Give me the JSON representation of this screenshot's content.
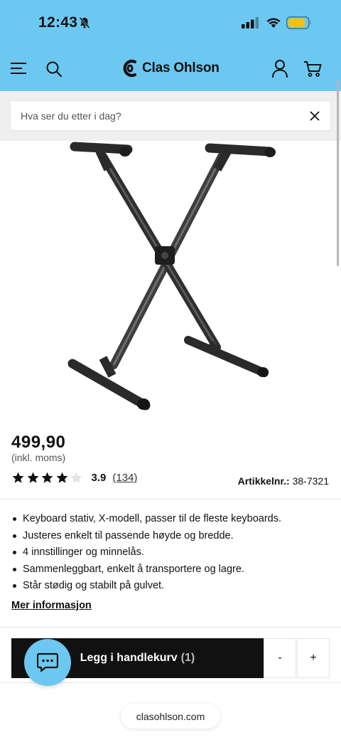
{
  "status_bar": {
    "time": "12:43",
    "icons": [
      "bell-slash-icon",
      "signal-icon",
      "wifi-icon",
      "battery-icon"
    ],
    "battery_color": "#f4c20d"
  },
  "header": {
    "brand": "Clas Ohlson",
    "background_color": "#6cc8f0",
    "icons": [
      "menu-icon",
      "search-icon",
      "logo-icon",
      "account-icon",
      "cart-icon"
    ]
  },
  "search": {
    "placeholder": "Hva ser du etter i dag?",
    "value": ""
  },
  "product": {
    "image_icon": "keyboard-x-stand",
    "price": "499,90",
    "price_note": "(inkl. moms)",
    "rating": {
      "stars_filled": 4,
      "stars_total": 5,
      "value": "3.9",
      "count_label": "(134)"
    },
    "sku_label": "Artikkelnr.:",
    "sku_value": "38-7321",
    "features": [
      "Keyboard stativ, X-modell, passer til de fleste keyboards.",
      "Justeres enkelt til passende høyde og bredde.",
      "4 innstillinger og minnelås.",
      "Sammenleggbart, enkelt å transportere og lagre.",
      "Står stødig og stabilt på gulvet."
    ],
    "more_info_label": "Mer informasjon"
  },
  "cart": {
    "button_label": "Legg i handlekurv",
    "quantity_label": "(1)",
    "minus_label": "-",
    "plus_label": "+"
  },
  "chat": {
    "icon": "chat-icon",
    "color": "#6cc8f0"
  },
  "browser": {
    "url": "clasohlson.com"
  }
}
